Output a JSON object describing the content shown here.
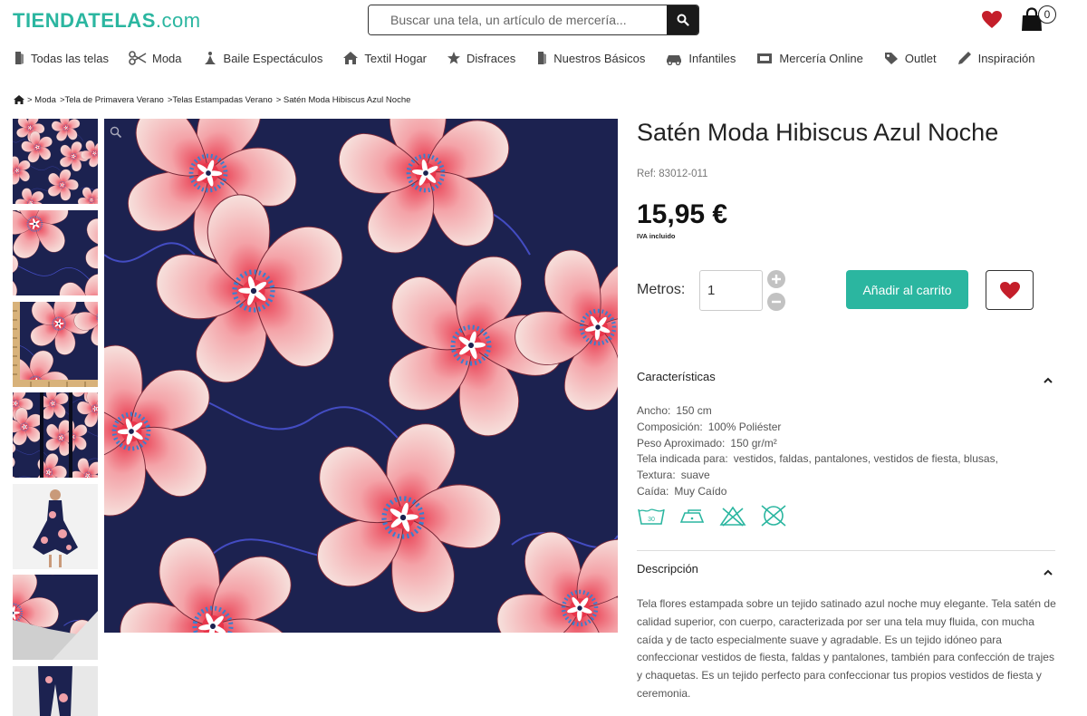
{
  "header": {
    "logo_main": "TIENDATELAS",
    "logo_suffix": ".com",
    "search_placeholder": "Buscar una tela, un artículo de mercería...",
    "cart_count": "0"
  },
  "nav": [
    {
      "label": "Todas las telas",
      "icon": "fabric-roll-icon"
    },
    {
      "label": "Moda",
      "icon": "scissors-icon"
    },
    {
      "label": "Baile Espectáculos",
      "icon": "dancer-icon"
    },
    {
      "label": "Textil Hogar",
      "icon": "home-icon"
    },
    {
      "label": "Disfraces",
      "icon": "star-icon"
    },
    {
      "label": "Nuestros Básicos",
      "icon": "fabric-roll-icon"
    },
    {
      "label": "Infantiles",
      "icon": "car-icon"
    },
    {
      "label": "Mercería Online",
      "icon": "sewing-kit-icon"
    },
    {
      "label": "Outlet",
      "icon": "tag-icon"
    },
    {
      "label": "Inspiración",
      "icon": "pencil-icon"
    }
  ],
  "breadcrumb": [
    "> Moda",
    ">Tela de Primavera Verano",
    ">Telas Estampadas Verano",
    "> Satén Moda Hibiscus Azul Noche"
  ],
  "product": {
    "title": "Satén Moda Hibiscus Azul Noche",
    "ref": "Ref: 83012-011",
    "price": "15,95 €",
    "vat_note": "IVA incluido",
    "quantity_label": "Metros:",
    "quantity_value": "1",
    "add_to_cart": "Añadir al carrito"
  },
  "characteristics": {
    "title": "Características",
    "items": [
      {
        "key": "Ancho:",
        "value": "150 cm"
      },
      {
        "key": "Composición:",
        "value": "100% Poliéster"
      },
      {
        "key": "Peso Aproximado:",
        "value": "150 gr/m²"
      },
      {
        "key": "Tela indicada para:",
        "value": "vestidos, faldas, pantalones, vestidos de fiesta, blusas,"
      },
      {
        "key": "Textura:",
        "value": "suave"
      },
      {
        "key": "Caída:",
        "value": "Muy Caído"
      }
    ],
    "care_icons": [
      "wash-30-icon",
      "iron-icon",
      "no-bleach-icon",
      "no-tumble-dry-icon"
    ],
    "wash_temp": "30"
  },
  "description": {
    "title": "Descripción",
    "text": "Tela flores estampada sobre un tejido satinado azul noche muy elegante. Tela satén de calidad superior, con cuerpo, caracterizada por ser una tela muy fluida, con mucha caída y de tacto especialmente suave y agradable. Es un tejido idóneo para confeccionar vestidos de fiesta, faldas y pantalones, también para confección de trajes y chaquetas. Es un tejido perfecto para confeccionar tus propios vestidos de fiesta y ceremonia."
  },
  "colors": {
    "accent": "#2bb6a0",
    "heart": "#c41e2a",
    "fabric_navy": "#1c2250"
  }
}
